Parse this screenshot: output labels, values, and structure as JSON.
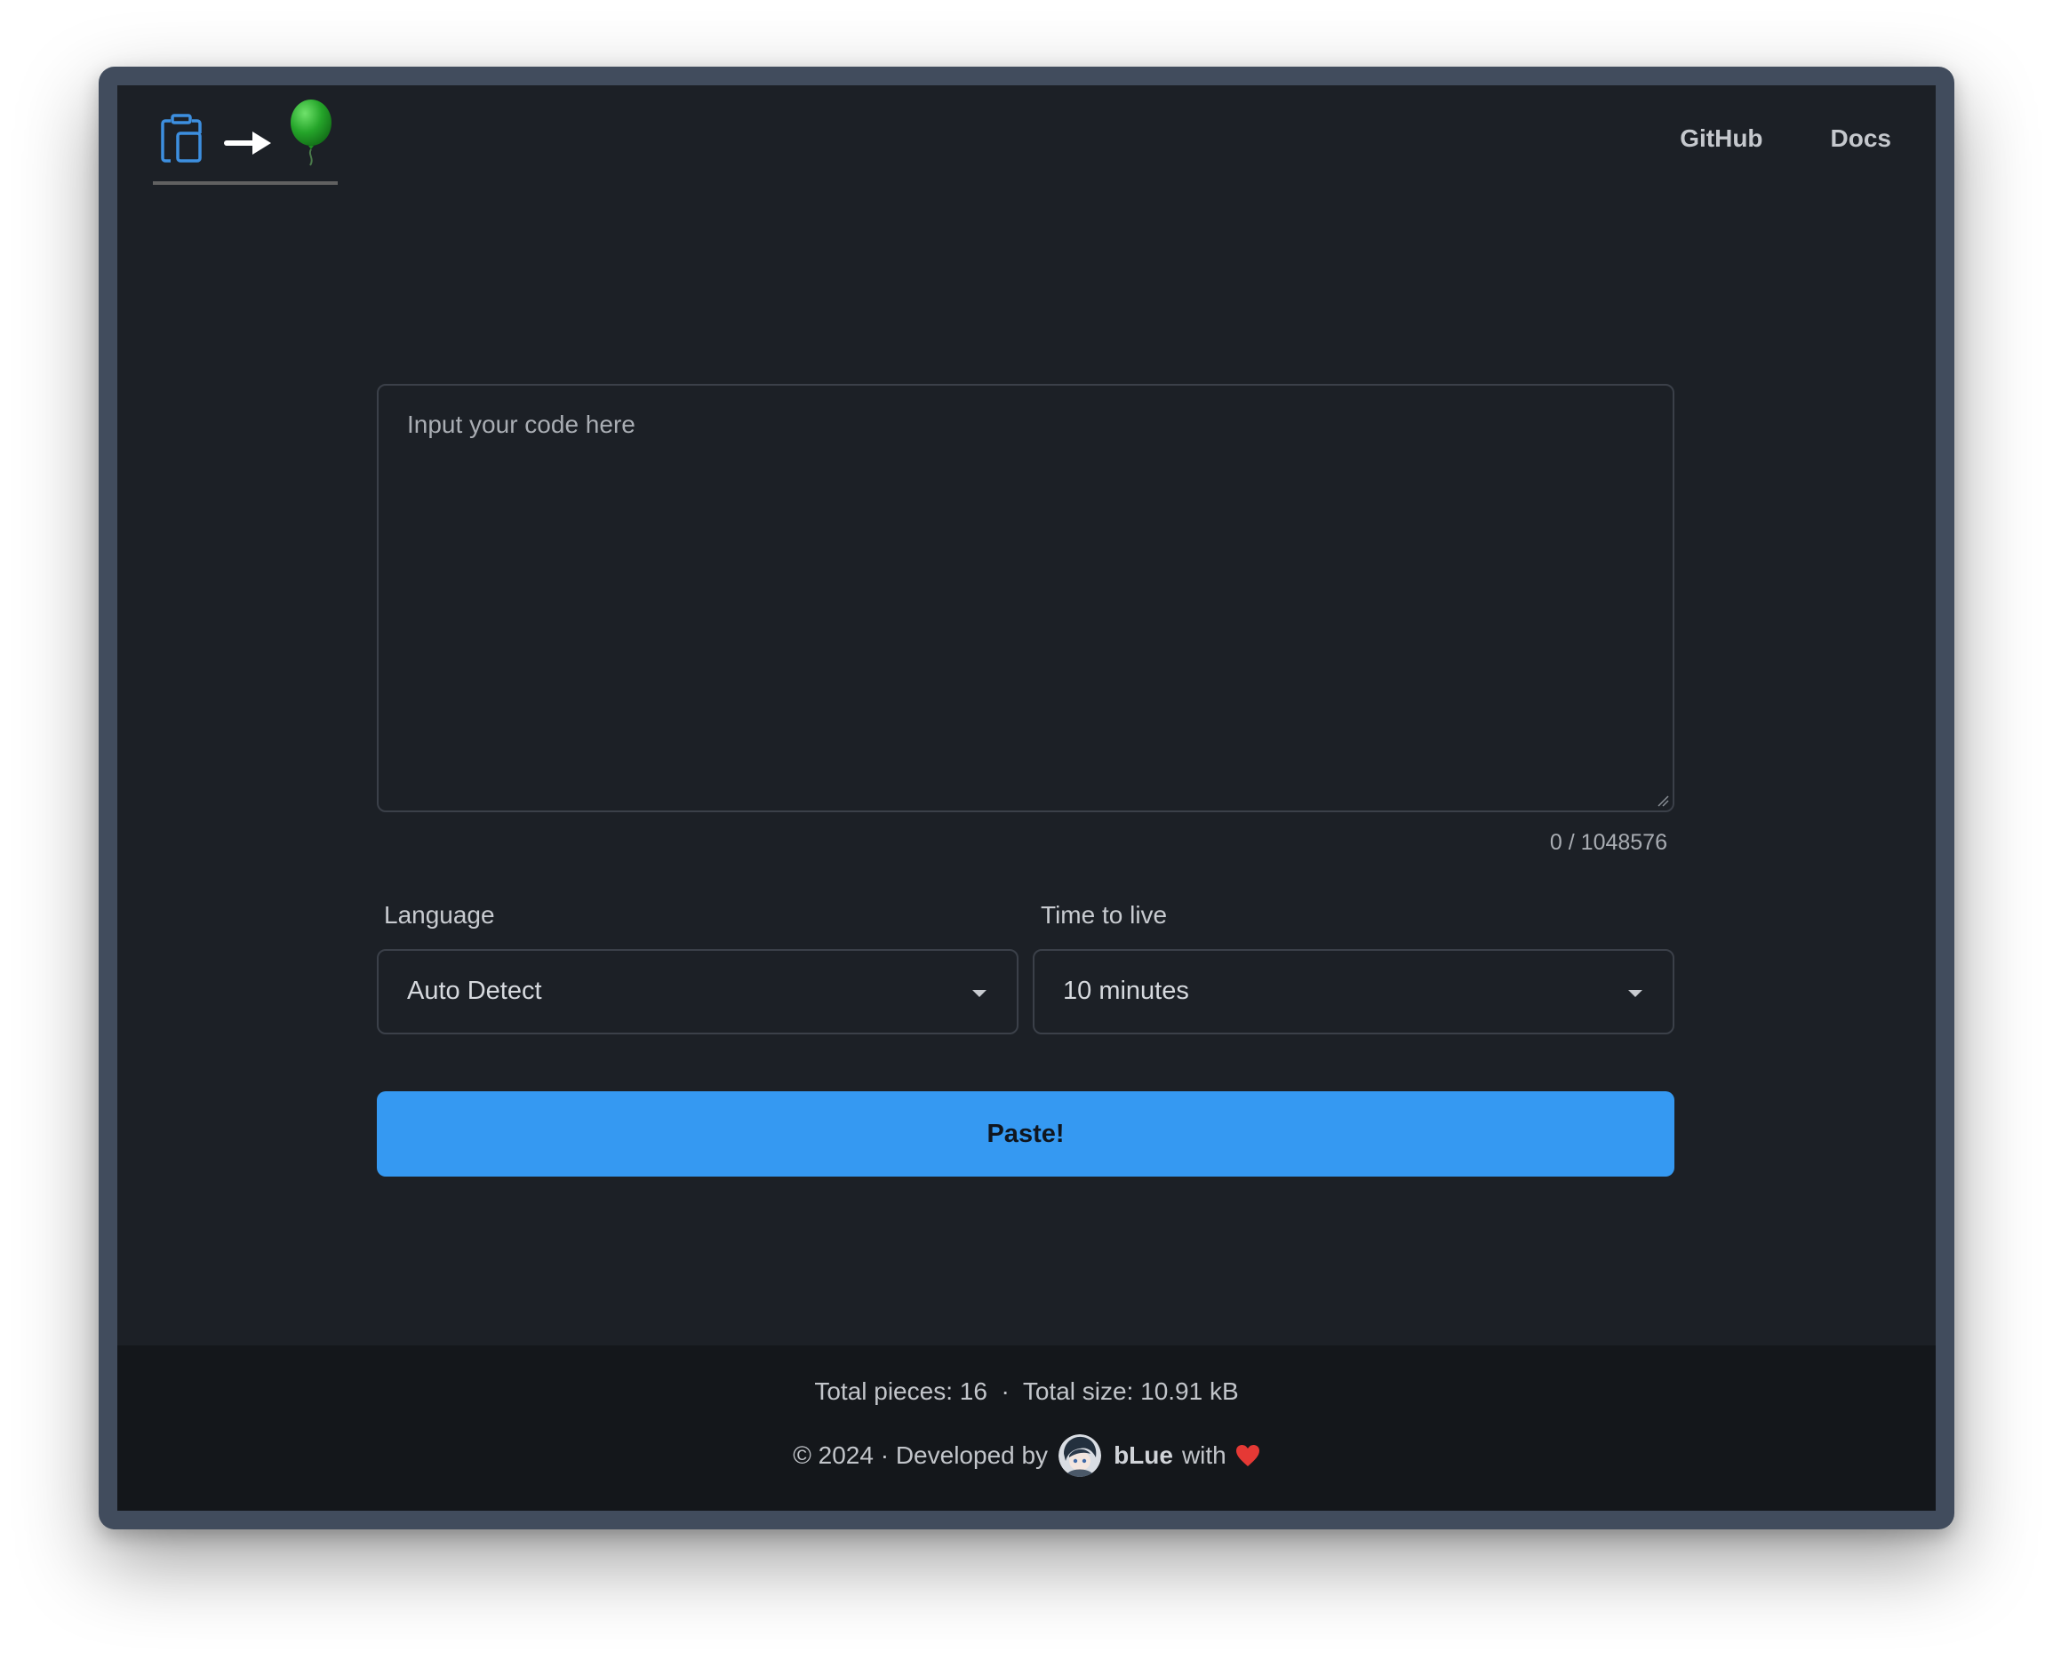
{
  "header": {
    "logo_icons": [
      "clipboard-icon",
      "arrow-right-icon",
      "balloon-icon"
    ],
    "nav": [
      {
        "label": "GitHub"
      },
      {
        "label": "Docs"
      }
    ]
  },
  "editor": {
    "placeholder": "Input your code here",
    "value": "",
    "counter": "0 / 1048576"
  },
  "language": {
    "label": "Language",
    "selected": "Auto Detect"
  },
  "ttl": {
    "label": "Time to live",
    "selected": "10 minutes"
  },
  "submit": {
    "label": "Paste!"
  },
  "footer": {
    "stats": "Total pieces: 16  ·  Total size: 10.91 kB",
    "credit_prefix": "© 2024 · Developed by",
    "author": "bLue",
    "credit_suffix": "with"
  },
  "colors": {
    "page_bg": "#1c2026",
    "footer_bg": "#14171b",
    "border": "#3b4049",
    "accent": "#3599f2",
    "clipboard": "#3d8fe0",
    "balloon": "#25a52a",
    "heart": "#e53935"
  }
}
